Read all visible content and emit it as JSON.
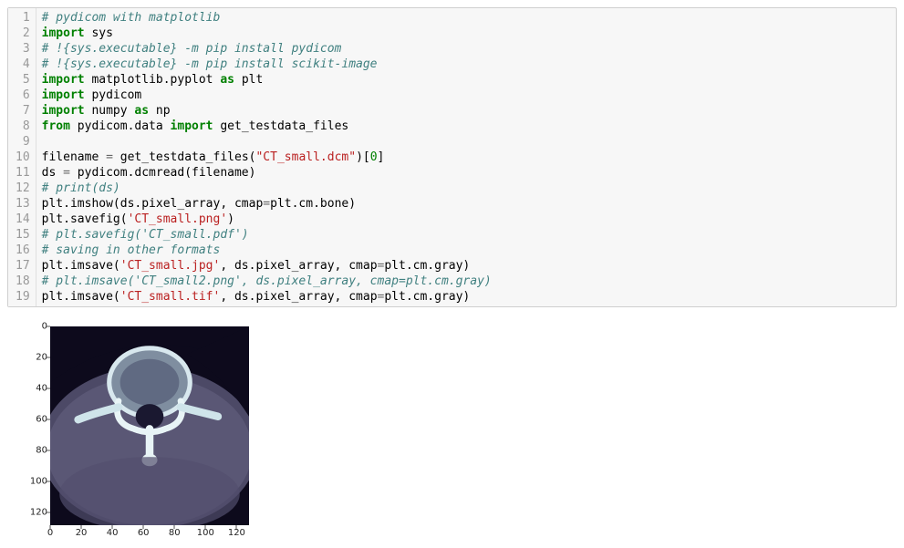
{
  "code": {
    "lines": [
      [
        {
          "cls": "tok-comment",
          "t": "# pydicom with matplotlib"
        }
      ],
      [
        {
          "cls": "tok-keyword",
          "t": "import"
        },
        {
          "cls": "tok-name",
          "t": " sys"
        }
      ],
      [
        {
          "cls": "tok-comment",
          "t": "# !{sys.executable} -m pip install pydicom"
        }
      ],
      [
        {
          "cls": "tok-comment",
          "t": "# !{sys.executable} -m pip install scikit-image"
        }
      ],
      [
        {
          "cls": "tok-keyword",
          "t": "import"
        },
        {
          "cls": "tok-name",
          "t": " matplotlib.pyplot "
        },
        {
          "cls": "tok-keyword",
          "t": "as"
        },
        {
          "cls": "tok-name",
          "t": " plt"
        }
      ],
      [
        {
          "cls": "tok-keyword",
          "t": "import"
        },
        {
          "cls": "tok-name",
          "t": " pydicom"
        }
      ],
      [
        {
          "cls": "tok-keyword",
          "t": "import"
        },
        {
          "cls": "tok-name",
          "t": " numpy "
        },
        {
          "cls": "tok-keyword",
          "t": "as"
        },
        {
          "cls": "tok-name",
          "t": " np"
        }
      ],
      [
        {
          "cls": "tok-keyword",
          "t": "from"
        },
        {
          "cls": "tok-name",
          "t": " pydicom.data "
        },
        {
          "cls": "tok-keyword",
          "t": "import"
        },
        {
          "cls": "tok-name",
          "t": " get_testdata_files"
        }
      ],
      [],
      [
        {
          "cls": "tok-name",
          "t": "filename "
        },
        {
          "cls": "tok-op",
          "t": "="
        },
        {
          "cls": "tok-name",
          "t": " get_testdata_files("
        },
        {
          "cls": "tok-string",
          "t": "\"CT_small.dcm\""
        },
        {
          "cls": "tok-name",
          "t": ")["
        },
        {
          "cls": "tok-number",
          "t": "0"
        },
        {
          "cls": "tok-name",
          "t": "]"
        }
      ],
      [
        {
          "cls": "tok-name",
          "t": "ds "
        },
        {
          "cls": "tok-op",
          "t": "="
        },
        {
          "cls": "tok-name",
          "t": " pydicom.dcmread(filename)"
        }
      ],
      [
        {
          "cls": "tok-comment",
          "t": "# print(ds)"
        }
      ],
      [
        {
          "cls": "tok-name",
          "t": "plt.imshow(ds.pixel_array, cmap"
        },
        {
          "cls": "tok-op",
          "t": "="
        },
        {
          "cls": "tok-name",
          "t": "plt.cm.bone)"
        }
      ],
      [
        {
          "cls": "tok-name",
          "t": "plt.savefig("
        },
        {
          "cls": "tok-string",
          "t": "'CT_small.png'"
        },
        {
          "cls": "tok-name",
          "t": ")"
        }
      ],
      [
        {
          "cls": "tok-comment",
          "t": "# plt.savefig('CT_small.pdf')"
        }
      ],
      [
        {
          "cls": "tok-comment",
          "t": "# saving in other formats"
        }
      ],
      [
        {
          "cls": "tok-name",
          "t": "plt.imsave("
        },
        {
          "cls": "tok-string",
          "t": "'CT_small.jpg'"
        },
        {
          "cls": "tok-name",
          "t": ", ds.pixel_array, cmap"
        },
        {
          "cls": "tok-op",
          "t": "="
        },
        {
          "cls": "tok-name",
          "t": "plt.cm.gray)"
        }
      ],
      [
        {
          "cls": "tok-comment",
          "t": "# plt.imsave('CT_small2.png', ds.pixel_array, cmap=plt.cm.gray)"
        }
      ],
      [
        {
          "cls": "tok-name",
          "t": "plt.imsave("
        },
        {
          "cls": "tok-string",
          "t": "'CT_small.tif'"
        },
        {
          "cls": "tok-name",
          "t": ", ds.pixel_array, cmap"
        },
        {
          "cls": "tok-op",
          "t": "="
        },
        {
          "cls": "tok-name",
          "t": "plt.cm.gray)"
        }
      ]
    ]
  },
  "chart_data": {
    "type": "image",
    "description": "matplotlib imshow of CT_small.dcm (pydicom test data) with bone colormap",
    "x_ticks": [
      0,
      20,
      40,
      60,
      80,
      100,
      120
    ],
    "y_ticks": [
      0,
      20,
      40,
      60,
      80,
      100,
      120
    ],
    "xlim": [
      0,
      128
    ],
    "ylim": [
      128,
      0
    ],
    "cmap": "bone"
  }
}
